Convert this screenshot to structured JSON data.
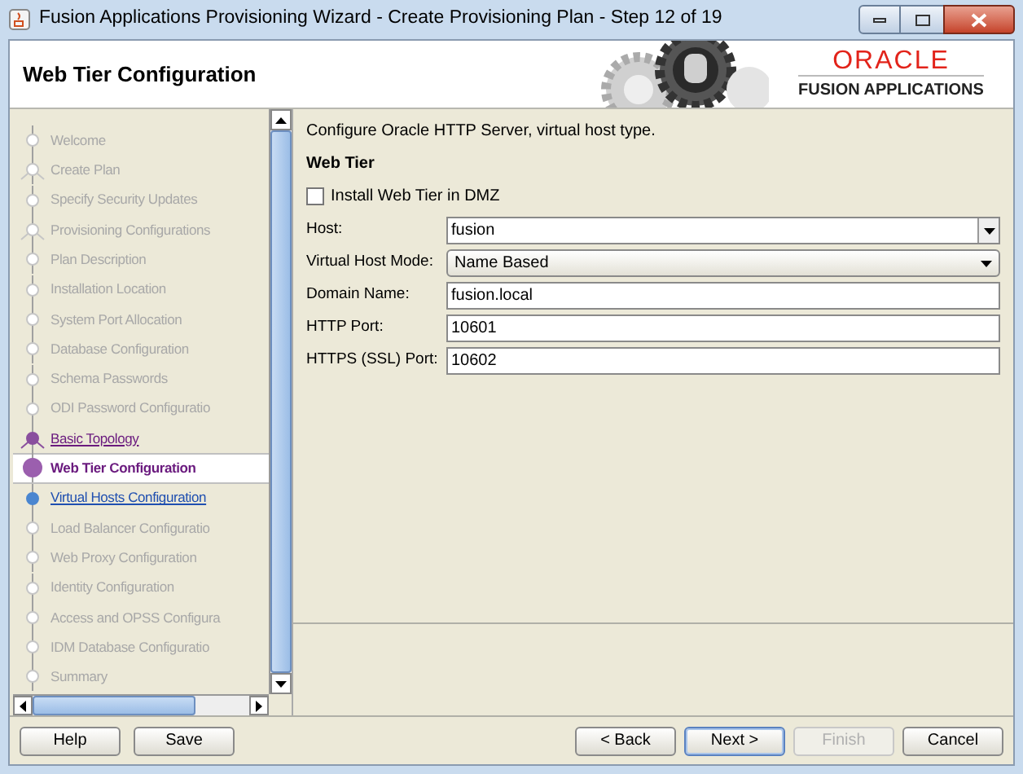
{
  "window": {
    "title": "Fusion Applications Provisioning Wizard - Create Provisioning Plan - Step 12 of 19"
  },
  "header": {
    "title": "Web Tier Configuration",
    "logo": {
      "brand": "ORACLE",
      "product": "FUSION APPLICATIONS"
    }
  },
  "steps": [
    {
      "label": "Welcome",
      "kind": "pending",
      "branch": false
    },
    {
      "label": "Create Plan",
      "kind": "pending",
      "branch": true
    },
    {
      "label": "Specify Security Updates",
      "kind": "pending",
      "branch": false
    },
    {
      "label": "Provisioning Configurations",
      "kind": "pending",
      "branch": true
    },
    {
      "label": "Plan Description",
      "kind": "pending",
      "branch": false
    },
    {
      "label": "Installation Location",
      "kind": "pending",
      "branch": false
    },
    {
      "label": "System Port Allocation",
      "kind": "pending",
      "branch": false
    },
    {
      "label": "Database Configuration",
      "kind": "pending",
      "branch": false
    },
    {
      "label": "Schema Passwords",
      "kind": "pending",
      "branch": false
    },
    {
      "label": "ODI Password Configuratio",
      "kind": "pending",
      "branch": false
    },
    {
      "label": "Basic Topology",
      "kind": "visited",
      "branch": true
    },
    {
      "label": "Web Tier Configuration",
      "kind": "current",
      "branch": false
    },
    {
      "label": "Virtual Hosts Configuration",
      "kind": "next",
      "branch": false
    },
    {
      "label": "Load Balancer Configuratio",
      "kind": "pending",
      "branch": false
    },
    {
      "label": "Web Proxy Configuration",
      "kind": "pending",
      "branch": false
    },
    {
      "label": "Identity Configuration",
      "kind": "pending",
      "branch": false
    },
    {
      "label": "Access and OPSS Configura",
      "kind": "pending",
      "branch": false
    },
    {
      "label": "IDM Database Configuratio",
      "kind": "pending",
      "branch": false
    },
    {
      "label": "Summary",
      "kind": "pending",
      "branch": false
    }
  ],
  "content": {
    "intro": "Configure Oracle HTTP Server, virtual host type.",
    "section": "Web Tier",
    "dmz": {
      "label": "Install Web Tier in DMZ",
      "checked": false
    },
    "fields": [
      {
        "kind": "combo",
        "label": "Host:",
        "value": "fusion"
      },
      {
        "kind": "select",
        "label": "Virtual Host Mode:",
        "value": "Name Based"
      },
      {
        "kind": "text",
        "label": "Domain Name:",
        "value": "fusion.local"
      },
      {
        "kind": "text",
        "label": "HTTP Port:",
        "value": "10601"
      },
      {
        "kind": "text",
        "label": "HTTPS (SSL) Port:",
        "value": "10602"
      }
    ]
  },
  "buttons_left": [
    {
      "label": "Help",
      "disabled": false,
      "default": false
    },
    {
      "label": "Save",
      "disabled": false,
      "default": false
    }
  ],
  "buttons_right": [
    {
      "label": "< Back",
      "disabled": false,
      "default": false
    },
    {
      "label": "Next >",
      "disabled": false,
      "default": true
    },
    {
      "label": "Finish",
      "disabled": true,
      "default": false
    },
    {
      "label": "Cancel",
      "disabled": false,
      "default": false
    }
  ]
}
